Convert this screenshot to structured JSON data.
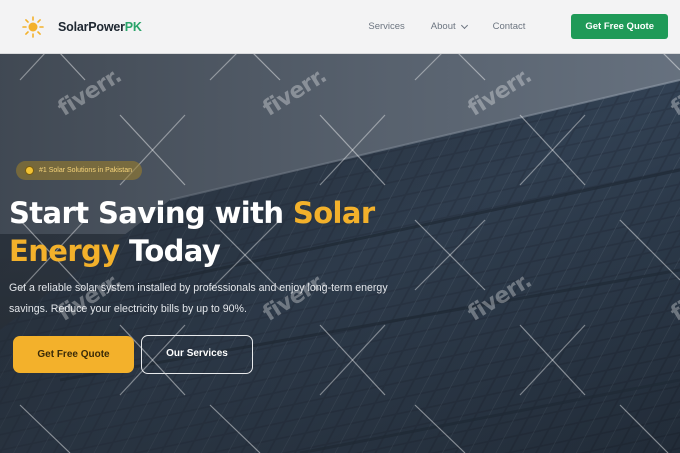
{
  "header": {
    "brand_main": "SolarPower",
    "brand_accent": "PK",
    "nav": [
      {
        "label": "Services"
      },
      {
        "label": "About"
      },
      {
        "label": "Contact"
      }
    ],
    "cta_label": "Get Free Quote"
  },
  "hero": {
    "badge": "#1 Solar Solutions in Pakistan",
    "headline_part1": "Start Saving with ",
    "headline_highlight1": "Solar",
    "headline_highlight2": "Energy",
    "headline_part2": " Today",
    "subtext": "Get a reliable solar system installed by professionals and enjoy long-term energy savings. Reduce your electricity bills by up to 90%.",
    "primary_button": "Get Free Quote",
    "secondary_button": "Our Services"
  },
  "watermark": "fiverr.",
  "colors": {
    "accent_yellow": "#f3b12b",
    "brand_green": "#1f9a58",
    "header_bg": "#f3f3f4"
  }
}
